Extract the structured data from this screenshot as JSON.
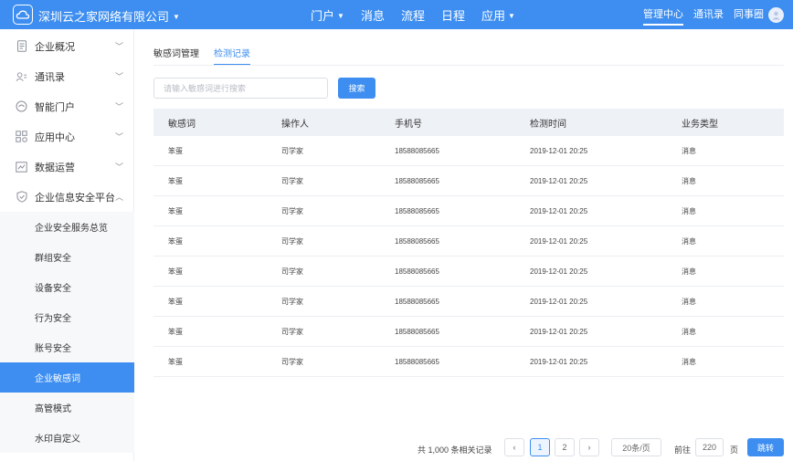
{
  "header": {
    "company": "深圳云之家网络有限公司",
    "nav": [
      "门户",
      "消息",
      "流程",
      "日程",
      "应用"
    ],
    "right": [
      "管理中心",
      "通讯录",
      "同事圈"
    ]
  },
  "sidebar": {
    "items": [
      {
        "label": "企业概况",
        "icon": "document-icon"
      },
      {
        "label": "通讯录",
        "icon": "contacts-icon"
      },
      {
        "label": "智能门户",
        "icon": "portal-icon"
      },
      {
        "label": "应用中心",
        "icon": "apps-icon"
      },
      {
        "label": "数据运营",
        "icon": "chart-icon"
      },
      {
        "label": "企业信息安全平台",
        "icon": "shield-icon"
      }
    ],
    "subitems": [
      "企业安全服务总览",
      "群组安全",
      "设备安全",
      "行为安全",
      "账号安全",
      "企业敏感词",
      "高管模式",
      "水印自定义"
    ]
  },
  "tabs": [
    "敏感词管理",
    "检测记录"
  ],
  "search": {
    "placeholder": "请输入敏感词进行搜索",
    "button": "搜索"
  },
  "table": {
    "headers": [
      "敏感词",
      "操作人",
      "手机号",
      "检测时间",
      "业务类型"
    ],
    "rows": [
      [
        "笨蛋",
        "司学家",
        "18588085665",
        "2019-12-01 20:25",
        "消息"
      ],
      [
        "笨蛋",
        "司学家",
        "18588085665",
        "2019-12-01 20:25",
        "消息"
      ],
      [
        "笨蛋",
        "司学家",
        "18588085665",
        "2019-12-01 20:25",
        "消息"
      ],
      [
        "笨蛋",
        "司学家",
        "18588085665",
        "2019-12-01 20:25",
        "消息"
      ],
      [
        "笨蛋",
        "司学家",
        "18588085665",
        "2019-12-01 20:25",
        "消息"
      ],
      [
        "笨蛋",
        "司学家",
        "18588085665",
        "2019-12-01 20:25",
        "消息"
      ],
      [
        "笨蛋",
        "司学家",
        "18588085665",
        "2019-12-01 20:25",
        "消息"
      ],
      [
        "笨蛋",
        "司学家",
        "18588085665",
        "2019-12-01 20:25",
        "消息"
      ]
    ]
  },
  "pagination": {
    "total": "共 1,000 条相关记录",
    "pages": [
      "1",
      "2"
    ],
    "page_size": "20条/页",
    "goto_label": "前往",
    "goto_value": "220",
    "page_unit": "页",
    "jump": "跳转"
  },
  "colors": {
    "accent": "#3d8ef0"
  }
}
